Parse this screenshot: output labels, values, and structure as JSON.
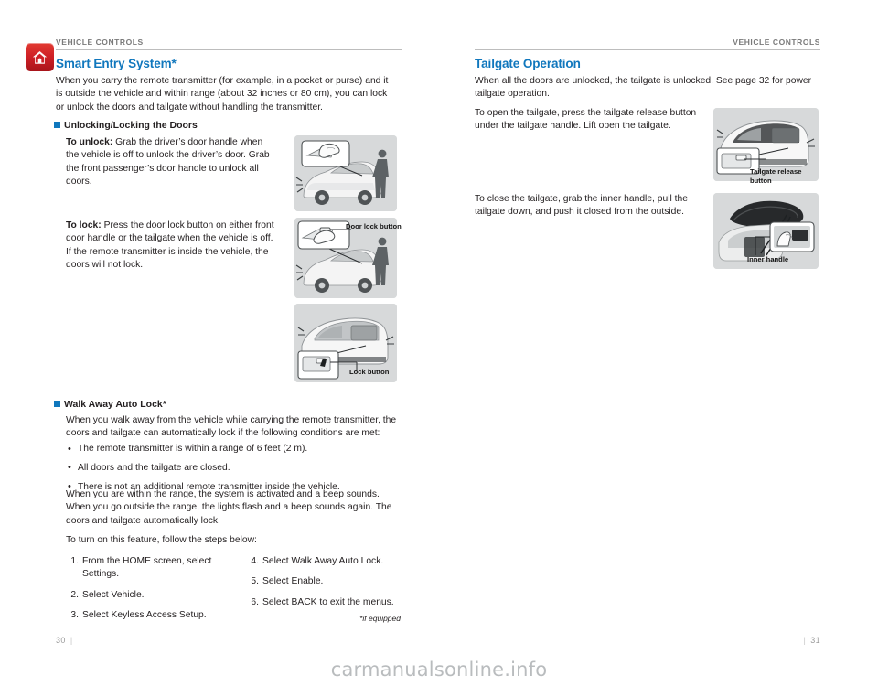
{
  "left_page": {
    "running_head": "VEHICLE CONTROLS",
    "home_icon": "home-icon",
    "section_title": "Smart Entry System*",
    "intro": "When you carry the remote transmitter (for example, in a pocket or purse) and it is outside the vehicle and within range (about 32 inches or 80 cm), you can lock or unlock the doors and tailgate without handling the transmitter.",
    "subhead_1": "Unlocking/Locking the Doors",
    "to_unlock_label": "To unlock:",
    "to_unlock_text": " Grab the driver’s door handle when the vehicle is off to unlock the driver’s door. Grab the front passenger’s door handle to unlock all doors.",
    "to_lock_label": "To lock:",
    "to_lock_text": " Press the door lock button on either front door handle or the tailgate when the vehicle is off. If the remote transmitter is inside the vehicle, the doors will not lock.",
    "subhead_2": "Walk Away Auto Lock*",
    "walk_intro": "When you walk away from the vehicle while carrying the remote transmitter, the doors and tailgate can automatically lock if the following conditions are met:",
    "conditions": [
      "The remote transmitter is within a range of 6 feet (2 m).",
      "All doors and the tailgate are closed.",
      "There is not an additional remote transmitter inside the vehicle."
    ],
    "walk_body": "When you are within the range, the system is activated and a beep sounds. When you go outside the range, the lights flash and a beep sounds again. The doors and tailgate automatically lock.",
    "walk_lead_in": "To turn on this feature, follow the steps below:",
    "steps_col1": [
      {
        "num": "1.",
        "text": "From the HOME screen, select Settings."
      },
      {
        "num": "2.",
        "text": "Select Vehicle."
      },
      {
        "num": "3.",
        "text": "Select Keyless Access Setup."
      }
    ],
    "steps_col2": [
      {
        "num": "4.",
        "text": "Select Walk Away Auto Lock."
      },
      {
        "num": "5.",
        "text": "Select Enable."
      },
      {
        "num": "6.",
        "text": "Select BACK to exit the menus."
      }
    ],
    "footnote": "*if equipped",
    "folio": "30",
    "figures": {
      "door_handle_unlock": {
        "name": "figure-door-handle-unlock",
        "caption": ""
      },
      "door_lock_button": {
        "name": "figure-door-lock-button",
        "caption": "Door lock button"
      },
      "tailgate_lock_button": {
        "name": "figure-tailgate-lock-button",
        "caption": "Lock button"
      }
    }
  },
  "right_page": {
    "running_head": "VEHICLE CONTROLS",
    "section_title": "Tailgate Operation",
    "intro": "When all the doors are unlocked, the tailgate is unlocked. See page 32 for power tailgate operation.",
    "open_text": "To open the tailgate, press the tailgate release button under the tailgate handle. Lift open the tailgate.",
    "close_text": "To close the tailgate, grab the inner handle, pull the tailgate down, and push it closed from the outside.",
    "folio": "31",
    "figures": {
      "tailgate_release": {
        "name": "figure-tailgate-release-button",
        "caption_line1": "Tailgate release",
        "caption_line2": "button"
      },
      "inner_handle": {
        "name": "figure-inner-handle",
        "caption": "Inner handle"
      }
    }
  },
  "watermark": "carmanualsonline.info",
  "colors": {
    "heading_blue": "#1077bd",
    "badge_red": "#cf2026",
    "rule_gray": "#bdbdbd",
    "runhead_gray": "#7a7a7a",
    "figure_bg": "#d7d9da"
  }
}
